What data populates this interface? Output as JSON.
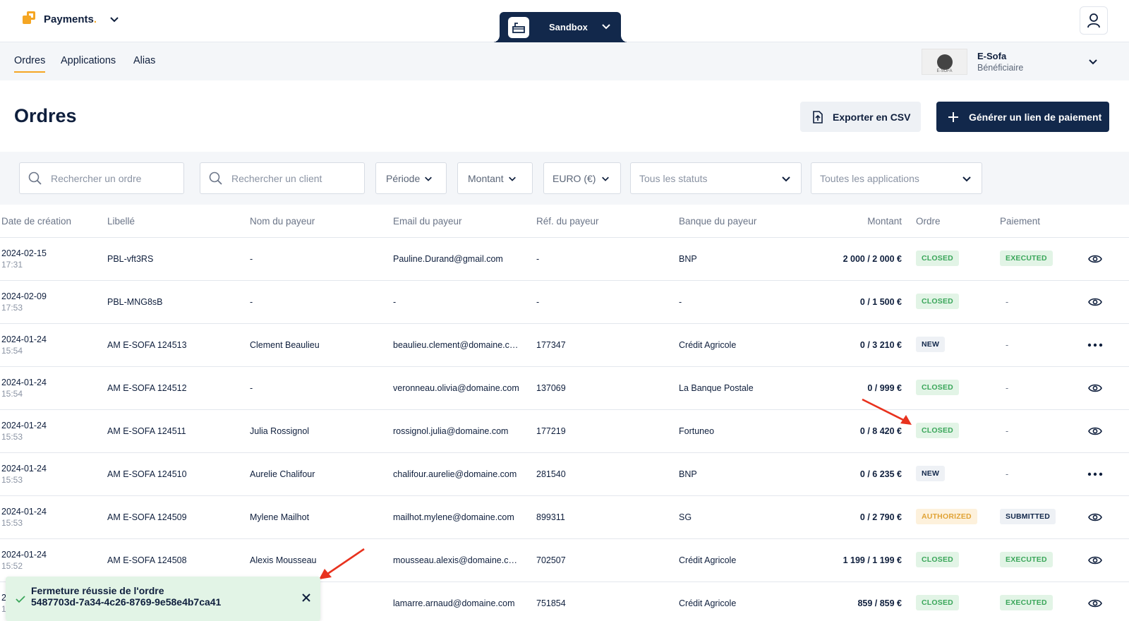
{
  "app": {
    "brand": "Payments",
    "brand_dot": ".",
    "environment": "Sandbox"
  },
  "nav": {
    "tabs": [
      {
        "label": "Ordres"
      },
      {
        "label": "Applications"
      },
      {
        "label": "Alias"
      }
    ]
  },
  "merchant": {
    "name": "E-Sofa",
    "role": "Bénéficiaire",
    "logo_text": "E-SOFA"
  },
  "page": {
    "title": "Ordres",
    "export_label": "Exporter en CSV",
    "generate_label": "Générer un lien de paiement"
  },
  "filters": {
    "search_order_placeholder": "Rechercher un ordre",
    "search_client_placeholder": "Rechercher un client",
    "period": "Période",
    "amount": "Montant",
    "currency": "EURO (€)",
    "status": "Tous les statuts",
    "applications": "Toutes les applications"
  },
  "table": {
    "headers": [
      "Date de création",
      "Libellé",
      "Nom du payeur",
      "Email du payeur",
      "Réf. du payeur",
      "Banque du payeur",
      "Montant",
      "Ordre",
      "Paiement"
    ],
    "rows": [
      {
        "date": "2024-02-15",
        "time": "17:31",
        "label": "PBL-vft3RS",
        "payer": "-",
        "email": "Pauline.Durand@gmail.com",
        "ref": "-",
        "bank": "BNP",
        "amount": "2 000 / 2 000 €",
        "order": "CLOSED",
        "payment": "EXECUTED",
        "action": "eye"
      },
      {
        "date": "2024-02-09",
        "time": "17:53",
        "label": "PBL-MNG8sB",
        "payer": "-",
        "email": "-",
        "ref": "-",
        "bank": "-",
        "amount": "0 / 1 500 €",
        "order": "CLOSED",
        "payment": "-",
        "action": "eye"
      },
      {
        "date": "2024-01-24",
        "time": "15:54",
        "label": "AM E-SOFA 124513",
        "payer": "Clement Beaulieu",
        "email": "beaulieu.clement@domaine.com",
        "ref": "177347",
        "bank": "Crédit Agricole",
        "amount": "0 / 3 210 €",
        "order": "NEW",
        "payment": "-",
        "action": "more"
      },
      {
        "date": "2024-01-24",
        "time": "15:54",
        "label": "AM E-SOFA 124512",
        "payer": "-",
        "email": "veronneau.olivia@domaine.com",
        "ref": "137069",
        "bank": "La Banque Postale",
        "amount": "0 / 999 €",
        "order": "CLOSED",
        "payment": "-",
        "action": "eye"
      },
      {
        "date": "2024-01-24",
        "time": "15:53",
        "label": "AM E-SOFA 124511",
        "payer": "Julia Rossignol",
        "email": "rossignol.julia@domaine.com",
        "ref": "177219",
        "bank": "Fortuneo",
        "amount": "0 / 8 420 €",
        "order": "CLOSED",
        "payment": "-",
        "action": "eye"
      },
      {
        "date": "2024-01-24",
        "time": "15:53",
        "label": "AM E-SOFA 124510",
        "payer": "Aurelie Chalifour",
        "email": "chalifour.aurelie@domaine.com",
        "ref": "281540",
        "bank": "BNP",
        "amount": "0 / 6 235 €",
        "order": "NEW",
        "payment": "-",
        "action": "more"
      },
      {
        "date": "2024-01-24",
        "time": "15:53",
        "label": "AM E-SOFA 124509",
        "payer": "Mylene Mailhot",
        "email": "mailhot.mylene@domaine.com",
        "ref": "899311",
        "bank": "SG",
        "amount": "0 / 2 790 €",
        "order": "AUTHORIZED",
        "payment": "SUBMITTED",
        "action": "eye"
      },
      {
        "date": "2024-01-24",
        "time": "15:52",
        "label": "AM E-SOFA 124508",
        "payer": "Alexis Mousseau",
        "email": "mousseau.alexis@domaine.com",
        "ref": "702507",
        "bank": "Crédit Agricole",
        "amount": "1 199 / 1 199 €",
        "order": "CLOSED",
        "payment": "EXECUTED",
        "action": "eye"
      },
      {
        "date": "2",
        "time": "1",
        "label": "",
        "payer": "",
        "email": "lamarre.arnaud@domaine.com",
        "ref": "751854",
        "bank": "Crédit Agricole",
        "amount": "859 / 859 €",
        "order": "CLOSED",
        "payment": "EXECUTED",
        "action": "eye"
      }
    ]
  },
  "toast": {
    "title": "Fermeture réussie de l'ordre",
    "order_id": "5487703d-7a34-4c26-8769-9e58e4b7ca41"
  },
  "colors": {
    "navy": "#12284b",
    "accent": "#f5a623",
    "success_bg": "#e2f4e6",
    "success_text": "#3aa65a",
    "warning_bg": "#fdf1dc",
    "warning_text": "#e0a336",
    "annotation_arrow": "#e8321e"
  }
}
